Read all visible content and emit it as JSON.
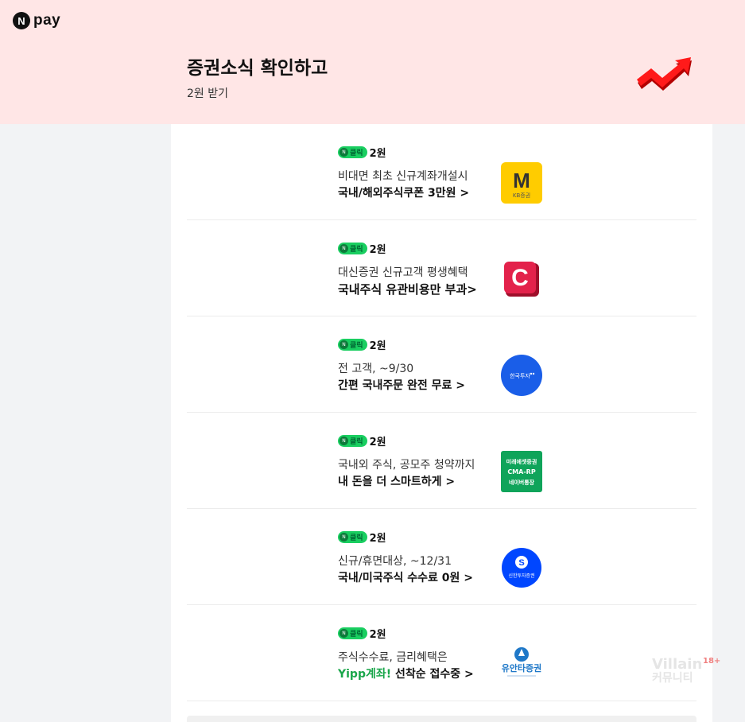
{
  "brand": {
    "badge": "N",
    "name": "pay"
  },
  "header": {
    "title": "증권소식 확인하고",
    "subtitle": "2원 받기"
  },
  "items": [
    {
      "badge": "클릭",
      "reward": "2원",
      "line1": "비대면 최초 신규계좌개설시",
      "line2": "국내/해외주식쿠폰 3만원",
      "chev": ">",
      "logo": "kb-securities-logo",
      "logo_text": [
        "M",
        "KB증권"
      ]
    },
    {
      "badge": "클릭",
      "reward": "2원",
      "line1": "대신증권 신규고객 평생혜택",
      "line2": "국내주식 유관비용만 부과>",
      "chev": "",
      "logo": "daishin-logo",
      "logo_text": [
        "C"
      ]
    },
    {
      "badge": "클릭",
      "reward": "2원",
      "line1": "전 고객, ~9/30",
      "line2": "간편 국내주문 완전 무료 >",
      "chev": "",
      "logo": "korea-investment-logo",
      "logo_text": [
        "한국투자"
      ]
    },
    {
      "badge": "클릭",
      "reward": "2원",
      "line1": "국내외 주식, 공모주 청약까지",
      "line2": "내 돈을 더 스마트하게 >",
      "chev": "",
      "logo": "mirae-asset-logo",
      "logo_text": [
        "미래에셋증권",
        "CMA-RP",
        "네이버통장"
      ]
    },
    {
      "badge": "클릭",
      "reward": "2원",
      "line1": "신규/휴면대상, ~12/31",
      "line2": "국내/미국주식 수수료 0원",
      "chev": ">",
      "logo": "shinhan-logo",
      "logo_text": [
        "신한투자증권"
      ]
    },
    {
      "badge": "클릭",
      "reward": "2원",
      "line1": "주식수수료, 금리혜택은",
      "line2_accent": "Yipp계좌!",
      "line2": " 선착순 접수중",
      "chev": ">",
      "logo": "yuanta-logo",
      "logo_text": [
        "유안타증권"
      ]
    }
  ],
  "watermark": {
    "text": "Villain",
    "sub": "커뮤니티",
    "age": "18+"
  },
  "colors": {
    "header_bg": "#ffe6e6",
    "pill_green": "#19ce60",
    "accent_green": "#19a64a"
  }
}
